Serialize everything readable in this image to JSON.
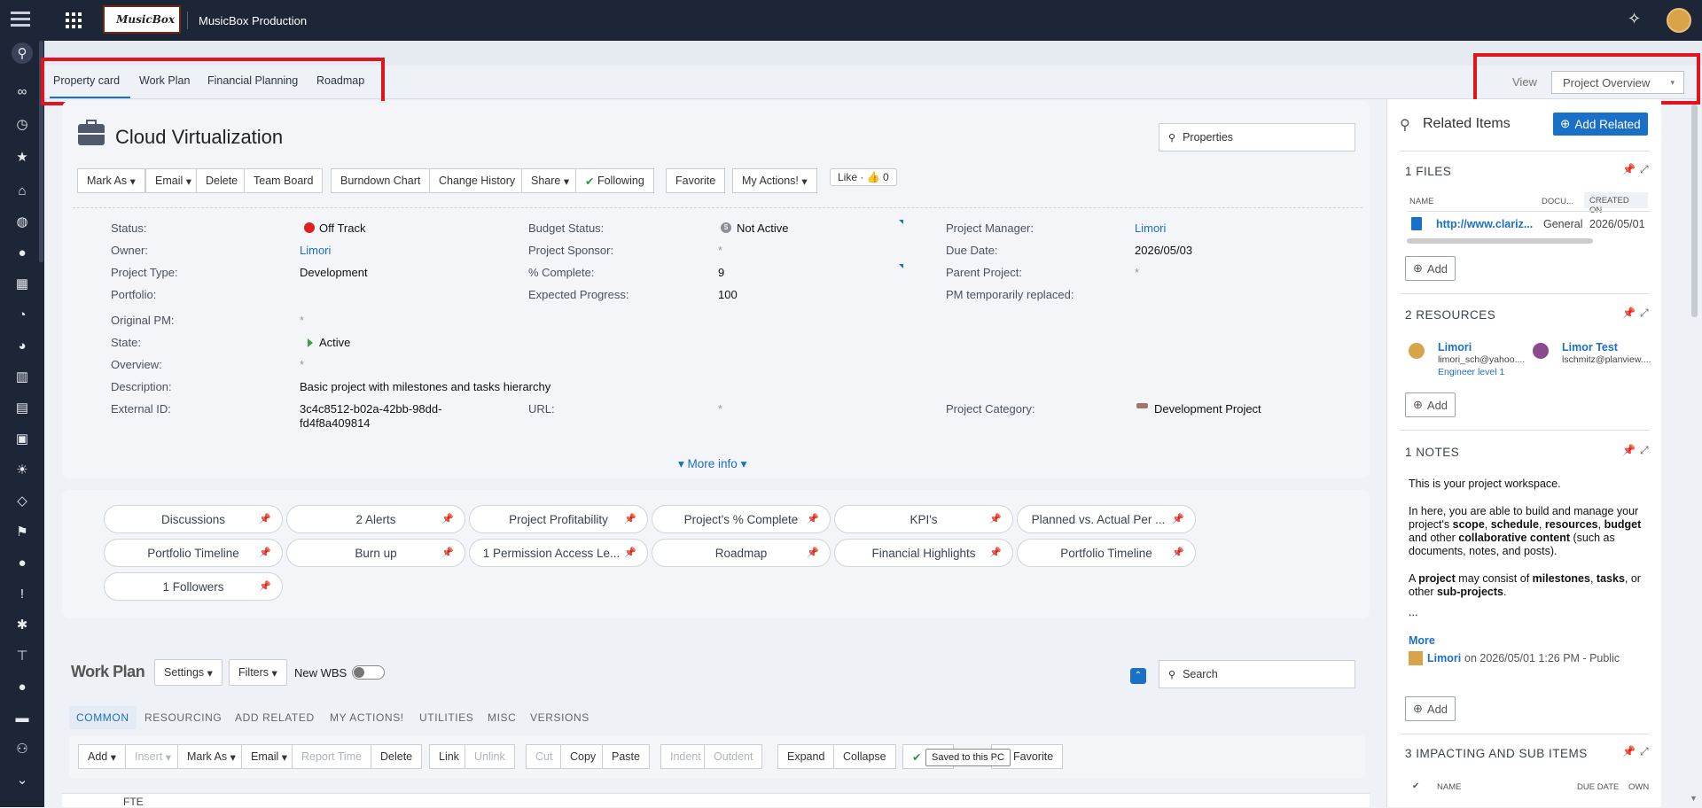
{
  "app": {
    "title": "MusicBox Production",
    "logo_text": "MusicBox"
  },
  "tabs": [
    "Property card",
    "Work Plan",
    "Financial Planning",
    "Roadmap"
  ],
  "view": {
    "label": "View",
    "selected": "Project Overview"
  },
  "project": {
    "title": "Cloud Virtualization",
    "search_placeholder": "Properties"
  },
  "toolbar": {
    "mark_as": "Mark As",
    "email": "Email",
    "delete": "Delete",
    "team_board": "Team Board",
    "burndown": "Burndown Chart",
    "change_history": "Change History",
    "share": "Share",
    "following": "Following",
    "favorite": "Favorite",
    "my_actions": "My Actions!",
    "like": "Like",
    "like_count": "0"
  },
  "fields": {
    "status_label": "Status:",
    "status_value": "Off Track",
    "owner_label": "Owner:",
    "owner_value": "Limori",
    "type_label": "Project Type:",
    "type_value": "Development",
    "portfolio_label": "Portfolio:",
    "budget_label": "Budget Status:",
    "budget_value": "Not Active",
    "sponsor_label": "Project Sponsor:",
    "sponsor_value": "*",
    "complete_label": "% Complete:",
    "complete_value": "9",
    "expected_label": "Expected Progress:",
    "expected_value": "100",
    "pm_label": "Project Manager:",
    "pm_value": "Limori",
    "due_label": "Due Date:",
    "due_value": "2026/05/03",
    "parent_label": "Parent Project:",
    "parent_value": "*",
    "pmtemp_label": "PM temporarily replaced:",
    "origpm_label": "Original PM:",
    "origpm_value": "*",
    "state_label": "State:",
    "state_value": "Active",
    "overview_label": "Overview:",
    "overview_value": "*",
    "desc_label": "Description:",
    "desc_value": "Basic project with milestones and tasks hierarchy",
    "extid_label": "External ID:",
    "extid_value_1": "3c4c8512-b02a-42bb-98dd-",
    "extid_value_2": "fd4f8a409814",
    "url_label": "URL:",
    "url_value": "*",
    "category_label": "Project Category:",
    "category_value": "Development Project",
    "more_info": "More info"
  },
  "pills": [
    "Discussions",
    "2 Alerts",
    "Project Profitability",
    "Project's % Complete",
    "KPI's",
    "Planned vs. Actual Per ...",
    "Portfolio Timeline",
    "Burn up",
    "1 Permission Access Le...",
    "Roadmap",
    "Financial Highlights",
    "Portfolio Timeline",
    "1 Followers"
  ],
  "workplan": {
    "title": "Work Plan",
    "settings": "Settings",
    "filters": "Filters",
    "new_wbs": "New WBS",
    "search_placeholder": "Search",
    "subtabs": [
      "COMMON",
      "RESOURCING",
      "ADD RELATED",
      "MY ACTIONS!",
      "UTILITIES",
      "MISC",
      "VERSIONS"
    ],
    "actions": [
      "Add",
      "Insert",
      "Mark As",
      "Email",
      "Report Time",
      "Delete",
      "Link",
      "Unlink",
      "Cut",
      "Copy",
      "Paste",
      "Indent",
      "Outdent",
      "Expand",
      "Collapse",
      "Favorite"
    ],
    "tooltip": "Saved to this PC",
    "grid_header": "FTE"
  },
  "related": {
    "title": "Related Items",
    "add_related": "Add Related",
    "files_title": "1 FILES",
    "files_cols": [
      "NAME",
      "DOCU...",
      "CREATED ON"
    ],
    "file_name": "http://www.clariz...",
    "file_type": "General",
    "file_date": "2026/05/01",
    "add": "Add",
    "resources_title": "2 RESOURCES",
    "res1_name": "Limori",
    "res1_email": "limori_sch@yahoo....",
    "res1_role": "Engineer level 1",
    "res2_name": "Limor Test",
    "res2_email": "lschmitz@planview....",
    "notes_title": "1 NOTES",
    "note_p1": "This is your project workspace.",
    "note_more_link": "More",
    "note_author": "Limori",
    "note_meta": "on 2026/05/01 1:26 PM - Public",
    "impact_title": "3 IMPACTING AND SUB ITEMS",
    "impact_cols": [
      "NAME",
      "DUE DATE",
      "OWN"
    ]
  },
  "colors": {
    "nav": "#1d2637",
    "accent": "#1a6fc7",
    "red_box": "#e0141e",
    "off_track": "#e02020"
  }
}
